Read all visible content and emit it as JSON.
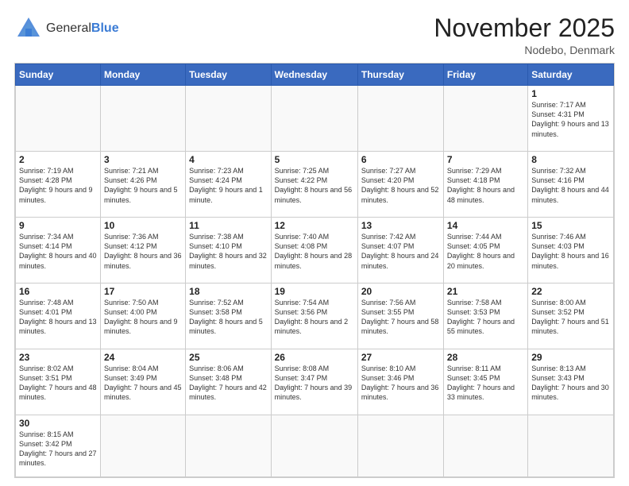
{
  "header": {
    "logo_general": "General",
    "logo_blue": "Blue",
    "title": "November 2025",
    "location": "Nodebo, Denmark"
  },
  "days_of_week": [
    "Sunday",
    "Monday",
    "Tuesday",
    "Wednesday",
    "Thursday",
    "Friday",
    "Saturday"
  ],
  "weeks": [
    [
      {
        "day": "",
        "info": ""
      },
      {
        "day": "",
        "info": ""
      },
      {
        "day": "",
        "info": ""
      },
      {
        "day": "",
        "info": ""
      },
      {
        "day": "",
        "info": ""
      },
      {
        "day": "",
        "info": ""
      },
      {
        "day": "1",
        "info": "Sunrise: 7:17 AM\nSunset: 4:31 PM\nDaylight: 9 hours and 13 minutes."
      }
    ],
    [
      {
        "day": "2",
        "info": "Sunrise: 7:19 AM\nSunset: 4:28 PM\nDaylight: 9 hours and 9 minutes."
      },
      {
        "day": "3",
        "info": "Sunrise: 7:21 AM\nSunset: 4:26 PM\nDaylight: 9 hours and 5 minutes."
      },
      {
        "day": "4",
        "info": "Sunrise: 7:23 AM\nSunset: 4:24 PM\nDaylight: 9 hours and 1 minute."
      },
      {
        "day": "5",
        "info": "Sunrise: 7:25 AM\nSunset: 4:22 PM\nDaylight: 8 hours and 56 minutes."
      },
      {
        "day": "6",
        "info": "Sunrise: 7:27 AM\nSunset: 4:20 PM\nDaylight: 8 hours and 52 minutes."
      },
      {
        "day": "7",
        "info": "Sunrise: 7:29 AM\nSunset: 4:18 PM\nDaylight: 8 hours and 48 minutes."
      },
      {
        "day": "8",
        "info": "Sunrise: 7:32 AM\nSunset: 4:16 PM\nDaylight: 8 hours and 44 minutes."
      }
    ],
    [
      {
        "day": "9",
        "info": "Sunrise: 7:34 AM\nSunset: 4:14 PM\nDaylight: 8 hours and 40 minutes."
      },
      {
        "day": "10",
        "info": "Sunrise: 7:36 AM\nSunset: 4:12 PM\nDaylight: 8 hours and 36 minutes."
      },
      {
        "day": "11",
        "info": "Sunrise: 7:38 AM\nSunset: 4:10 PM\nDaylight: 8 hours and 32 minutes."
      },
      {
        "day": "12",
        "info": "Sunrise: 7:40 AM\nSunset: 4:08 PM\nDaylight: 8 hours and 28 minutes."
      },
      {
        "day": "13",
        "info": "Sunrise: 7:42 AM\nSunset: 4:07 PM\nDaylight: 8 hours and 24 minutes."
      },
      {
        "day": "14",
        "info": "Sunrise: 7:44 AM\nSunset: 4:05 PM\nDaylight: 8 hours and 20 minutes."
      },
      {
        "day": "15",
        "info": "Sunrise: 7:46 AM\nSunset: 4:03 PM\nDaylight: 8 hours and 16 minutes."
      }
    ],
    [
      {
        "day": "16",
        "info": "Sunrise: 7:48 AM\nSunset: 4:01 PM\nDaylight: 8 hours and 13 minutes."
      },
      {
        "day": "17",
        "info": "Sunrise: 7:50 AM\nSunset: 4:00 PM\nDaylight: 8 hours and 9 minutes."
      },
      {
        "day": "18",
        "info": "Sunrise: 7:52 AM\nSunset: 3:58 PM\nDaylight: 8 hours and 5 minutes."
      },
      {
        "day": "19",
        "info": "Sunrise: 7:54 AM\nSunset: 3:56 PM\nDaylight: 8 hours and 2 minutes."
      },
      {
        "day": "20",
        "info": "Sunrise: 7:56 AM\nSunset: 3:55 PM\nDaylight: 7 hours and 58 minutes."
      },
      {
        "day": "21",
        "info": "Sunrise: 7:58 AM\nSunset: 3:53 PM\nDaylight: 7 hours and 55 minutes."
      },
      {
        "day": "22",
        "info": "Sunrise: 8:00 AM\nSunset: 3:52 PM\nDaylight: 7 hours and 51 minutes."
      }
    ],
    [
      {
        "day": "23",
        "info": "Sunrise: 8:02 AM\nSunset: 3:51 PM\nDaylight: 7 hours and 48 minutes."
      },
      {
        "day": "24",
        "info": "Sunrise: 8:04 AM\nSunset: 3:49 PM\nDaylight: 7 hours and 45 minutes."
      },
      {
        "day": "25",
        "info": "Sunrise: 8:06 AM\nSunset: 3:48 PM\nDaylight: 7 hours and 42 minutes."
      },
      {
        "day": "26",
        "info": "Sunrise: 8:08 AM\nSunset: 3:47 PM\nDaylight: 7 hours and 39 minutes."
      },
      {
        "day": "27",
        "info": "Sunrise: 8:10 AM\nSunset: 3:46 PM\nDaylight: 7 hours and 36 minutes."
      },
      {
        "day": "28",
        "info": "Sunrise: 8:11 AM\nSunset: 3:45 PM\nDaylight: 7 hours and 33 minutes."
      },
      {
        "day": "29",
        "info": "Sunrise: 8:13 AM\nSunset: 3:43 PM\nDaylight: 7 hours and 30 minutes."
      }
    ],
    [
      {
        "day": "30",
        "info": "Sunrise: 8:15 AM\nSunset: 3:42 PM\nDaylight: 7 hours and 27 minutes."
      },
      {
        "day": "",
        "info": ""
      },
      {
        "day": "",
        "info": ""
      },
      {
        "day": "",
        "info": ""
      },
      {
        "day": "",
        "info": ""
      },
      {
        "day": "",
        "info": ""
      },
      {
        "day": "",
        "info": ""
      }
    ]
  ]
}
